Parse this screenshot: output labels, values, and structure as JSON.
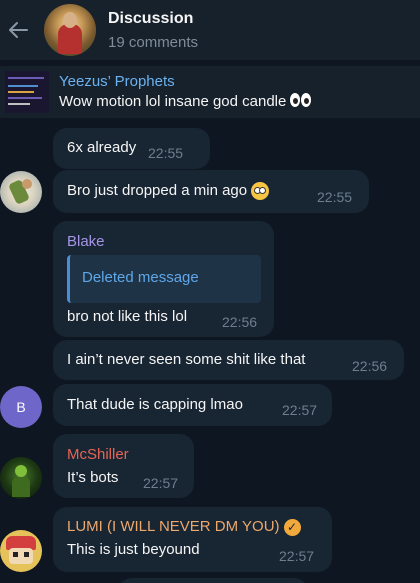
{
  "header": {
    "back_icon": "arrow-left-icon",
    "title": "Discussion",
    "subtitle": "19 comments"
  },
  "pinned": {
    "author": "Yeezus’ Prophets",
    "text": "Wow motion lol insane god candle"
  },
  "messages": [
    {
      "text": "6x already",
      "time": "22:55"
    },
    {
      "text": "Bro just dropped a min ago",
      "time": "22:55"
    },
    {
      "sender": "Blake",
      "quote": "Deleted message",
      "text": "bro not like this lol",
      "time": "22:56"
    },
    {
      "text": "I ain’t never seen some shit like that",
      "time": "22:56"
    },
    {
      "avatar_letter": "B",
      "text": "That dude is capping lmao",
      "time": "22:57"
    },
    {
      "sender": "McShiller",
      "text": "It’s bots",
      "time": "22:57"
    },
    {
      "sender": "LUMI (I WILL NEVER DM YOU)",
      "text": "This is just beyound",
      "time": "22:57"
    }
  ],
  "colors": {
    "background": "#0e1621",
    "bubble": "#182533",
    "header": "#17212b",
    "link_blue": "#6ab2f2",
    "blake": "#a695e7",
    "mcshiller": "#e56555",
    "lumi": "#eda86c"
  }
}
